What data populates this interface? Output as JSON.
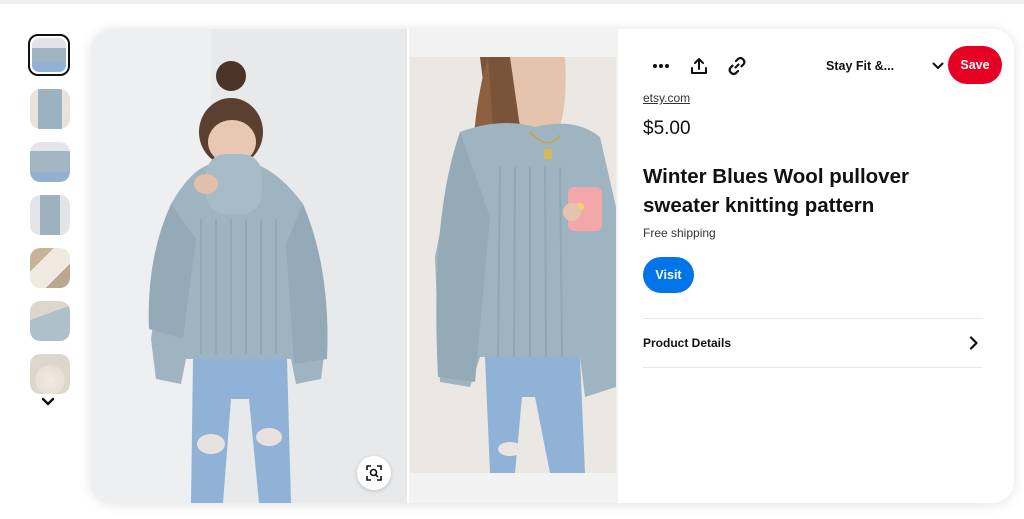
{
  "gallery": {
    "thumbnails": [
      {
        "alt": "blue sweater front",
        "bg": "#9fb3c0",
        "accent": "#dfe3e6"
      },
      {
        "alt": "blue sweater with mug",
        "bg": "#9bb2c0",
        "accent": "#e8e2da"
      },
      {
        "alt": "blue sweater side",
        "bg": "#a3b6c3",
        "accent": "#e6e6e8"
      },
      {
        "alt": "blue sweater standing",
        "bg": "#9eb1bf",
        "accent": "#e2e4e7"
      },
      {
        "alt": "cream knit with scarf",
        "bg": "#e7e1d6",
        "accent": "#c6b39a"
      },
      {
        "alt": "knitting closeup",
        "bg": "#aec0c8",
        "accent": "#dcd6cc"
      },
      {
        "alt": "cream sweater",
        "bg": "#ece5da",
        "accent": "#d8ccbb"
      }
    ],
    "more_icon": "chevron-down-icon"
  },
  "toolbar": {
    "more_icon": "more-dots-icon",
    "share_icon": "share-icon",
    "link_icon": "link-icon",
    "board_name": "Stay Fit &...",
    "board_dropdown_icon": "chevron-down-icon",
    "save_label": "Save"
  },
  "product": {
    "source": "etsy.com",
    "price": "$5.00",
    "title": "Winter Blues Wool pullover sweater knitting pattern",
    "shipping": "Free shipping",
    "visit_label": "Visit",
    "details_label": "Product Details"
  },
  "colors": {
    "save": "#e60023",
    "visit": "#0074e8",
    "sweater": "#9fb4c1"
  }
}
